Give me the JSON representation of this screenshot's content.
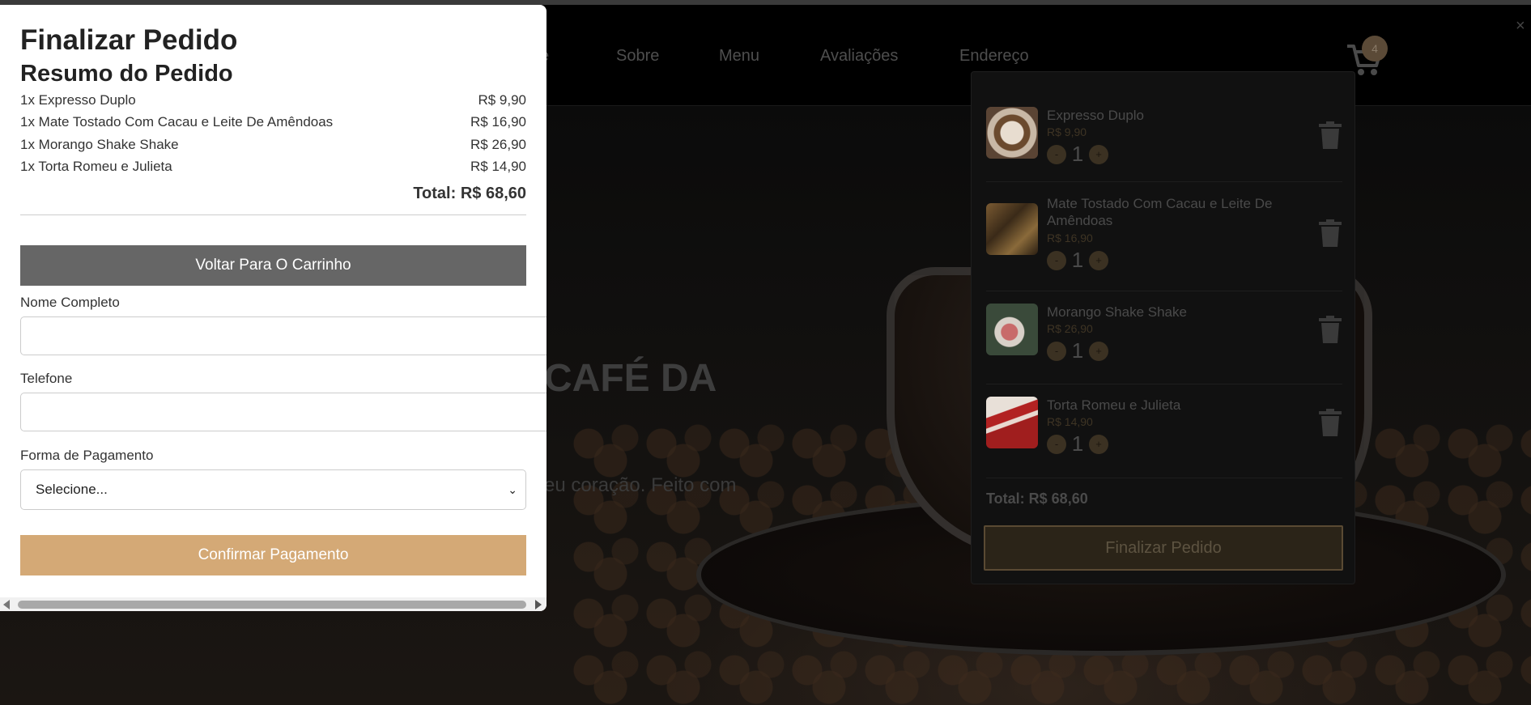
{
  "nav": {
    "items": [
      "e",
      "Sobre",
      "Menu",
      "Avaliações",
      "Endereço"
    ],
    "cart_count": "4",
    "close_symbol": "×"
  },
  "hero": {
    "title_partial": "CAFÉ DA",
    "subtitle_partial": "eu coração. Feito com"
  },
  "cart": {
    "items": [
      {
        "name": "Expresso Duplo",
        "price": "R$ 9,90",
        "qty": "1",
        "minus": "-",
        "plus": "+"
      },
      {
        "name": "Mate Tostado Com Cacau e Leite De Amêndoas",
        "price": "R$ 16,90",
        "qty": "1",
        "minus": "-",
        "plus": "+"
      },
      {
        "name": "Morango Shake Shake",
        "price": "R$ 26,90",
        "qty": "1",
        "minus": "-",
        "plus": "+"
      },
      {
        "name": "Torta Romeu e Julieta",
        "price": "R$ 14,90",
        "qty": "1",
        "minus": "-",
        "plus": "+"
      }
    ],
    "total": "Total: R$ 68,60",
    "finalize_label": "Finalizar Pedido"
  },
  "checkout": {
    "title": "Finalizar Pedido",
    "summary_title": "Resumo do Pedido",
    "summary": [
      {
        "line": "1x Expresso Duplo",
        "amount": "R$ 9,90"
      },
      {
        "line": "1x Mate Tostado Com Cacau e Leite De Amêndoas",
        "amount": "R$ 16,90"
      },
      {
        "line": "1x Morango Shake Shake",
        "amount": "R$ 26,90"
      },
      {
        "line": "1x Torta Romeu e Julieta",
        "amount": "R$ 14,90"
      }
    ],
    "total": "Total: R$ 68,60",
    "back_label": "Voltar Para O Carrinho",
    "name_label": "Nome Completo",
    "name_value": "",
    "phone_label": "Telefone",
    "phone_value": "",
    "payment_label": "Forma de Pagamento",
    "payment_selected": "Selecione...",
    "confirm_label": "Confirmar Pagamento"
  },
  "colors": {
    "accent": "#d4a976",
    "back_button": "#666666",
    "modal_bg": "#ffffff"
  }
}
